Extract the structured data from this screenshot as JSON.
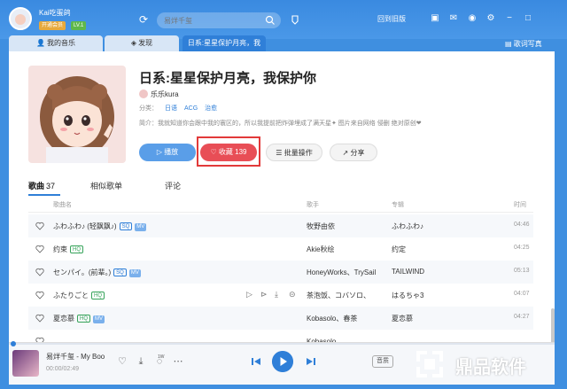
{
  "window": {
    "app_name": "Kai吃蛋鸽",
    "vip_badge": "开通会员",
    "level_badge": "LV.1",
    "search_placeholder": "易烊千玺",
    "old_version_link": "回到旧版"
  },
  "tabs": [
    {
      "label": "我的音乐",
      "icon": "user-icon"
    },
    {
      "label": "发现",
      "icon": "discover-icon"
    },
    {
      "label": "日系:星星保护月亮，我",
      "active": true
    }
  ],
  "right_tab": {
    "label": "歌词写真"
  },
  "playlist": {
    "title": "日系:星星保护月亮，我保护你",
    "creator": "乐乐kura",
    "category_label": "分类：",
    "tags": [
      "日语",
      "ACG",
      "治愈"
    ],
    "description": "简介：我就知道你会跟中我的寰区的，所以我提前把炸弹埋成了满天星✦ 图片来自网络 侵删 绝对原创❤"
  },
  "buttons": {
    "play": "播放",
    "favorite": "收藏 139",
    "batch": "批量操作",
    "share": "分享"
  },
  "subtabs": {
    "songs": "歌曲",
    "songs_count": "37",
    "similar": "相似歌单",
    "comments": "评论"
  },
  "columns": {
    "name": "歌曲名",
    "artist": "歌手",
    "album": "专辑",
    "duration": "时间"
  },
  "songs": [
    {
      "title": "ふわふわ♪ (轻飘飘♪)",
      "badges": [
        "SQ",
        "MV"
      ],
      "artist": "牧野由依",
      "album": "ふわふわ♪",
      "duration": "04:46"
    },
    {
      "title": "约束",
      "badges": [
        "HQ"
      ],
      "artist": "Akie秋绘",
      "album": "约定",
      "duration": "04:25"
    },
    {
      "title": "センパイ。(前辈。)",
      "badges": [
        "SQ",
        "MV"
      ],
      "artist": "HoneyWorks、TrySail",
      "album": "TAILWIND",
      "duration": "05:13"
    },
    {
      "title": "ふたりごと",
      "badges": [
        "HQ"
      ],
      "artist": "茶泡饭、コバソロ、",
      "album": "はるちゃ3",
      "duration": "04:07"
    },
    {
      "title": "夏恋慕",
      "badges": [
        "HQ",
        "MV"
      ],
      "artist": "Kobasolo、春茶",
      "album": "夏恋慕",
      "duration": "04:27"
    },
    {
      "title": "...",
      "badges": [],
      "artist": "Kobasolo、...",
      "album": "...",
      "duration": ""
    }
  ],
  "player": {
    "now_playing": "易烊千玺 - My Boo",
    "time": "00:00/02:49",
    "progress": 0.0,
    "quality": "音质",
    "download_tag": "1W"
  },
  "watermark": {
    "text": "鼎品软件"
  },
  "colors": {
    "accent": "#2f7fd8",
    "titlebar": "#3f8fe0",
    "favorite": "#e84e56",
    "highlight_box": "#e23a3a"
  }
}
